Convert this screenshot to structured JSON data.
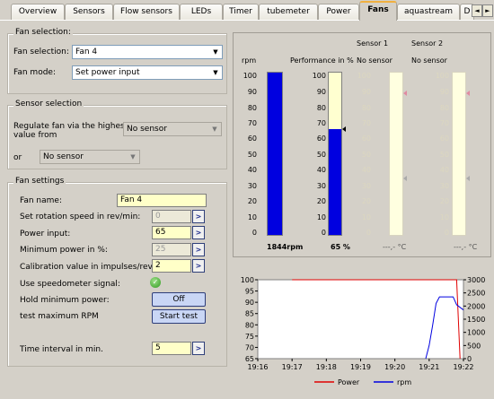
{
  "tabs": [
    "Overview",
    "Sensors",
    "Flow sensors",
    "LEDs",
    "Timer",
    "tubemeter",
    "Power",
    "Fans",
    "aquastream",
    "D"
  ],
  "active_tab": "Fans",
  "tab_scroll": {
    "left": "◄",
    "right": "►"
  },
  "fan_selection": {
    "title": "Fan selection:",
    "fan_label": "Fan selection:",
    "fan_value": "Fan 4",
    "mode_label": "Fan mode:",
    "mode_value": "Set power input"
  },
  "sensor_selection": {
    "title": "Sensor selection",
    "regulate_label_1": "Regulate fan via the highest",
    "regulate_label_2": "value from",
    "sensor1_value": "No sensor",
    "or_label": "or",
    "sensor2_value": "No sensor"
  },
  "fan_settings": {
    "title": "Fan settings",
    "name_label": "Fan name:",
    "name_value": "Fan 4",
    "rotation_label": "Set rotation speed in rev/min:",
    "rotation_value": "0",
    "power_label": "Power input:",
    "power_value": "65",
    "minpower_label": "Minimum power in %:",
    "minpower_value": "25",
    "calib_label": "Calibration value in impulses/rev:",
    "calib_value": "2",
    "speedometer_label": "Use speedometer signal:",
    "holdmin_label": "Hold minimum power:",
    "holdmin_button": "Off",
    "testmax_label": "test maximum RPM",
    "testmax_button": "Start test",
    "interval_label": "Time interval in min.",
    "interval_value": "5",
    "spin_symbol": ">"
  },
  "gauges": {
    "ticks": [
      "100",
      "90",
      "80",
      "70",
      "60",
      "50",
      "40",
      "30",
      "20",
      "10",
      "0"
    ],
    "rpm": {
      "header": "rpm",
      "value": "1844rpm",
      "level": 1.0,
      "color": "#0000e0"
    },
    "performance": {
      "header": "Performance in %",
      "value": "65 %",
      "level": 0.65,
      "color": "#0000e0"
    },
    "sensor1": {
      "header": "Sensor 1",
      "status": "No sensor",
      "value": "---,- °C"
    },
    "sensor2": {
      "header": "Sensor 2",
      "status": "No sensor",
      "value": "---,- °C"
    }
  },
  "chart_data": {
    "type": "line",
    "x_ticks": [
      "19:16",
      "19:17",
      "19:18",
      "19:19",
      "19:20",
      "19:21",
      "19:22"
    ],
    "y_left_ticks": [
      "100",
      "95",
      "90",
      "85",
      "80",
      "75",
      "70",
      "65"
    ],
    "y_right_ticks": [
      "3000",
      "2500",
      "2000",
      "1500",
      "1000",
      "500",
      "0"
    ],
    "y_left_range": [
      65,
      100
    ],
    "y_right_range": [
      0,
      3000
    ],
    "x_range_min": [
      0,
      6
    ],
    "series": [
      {
        "name": "Power",
        "color": "#e00000",
        "axis": "left",
        "points": [
          [
            1,
            100
          ],
          [
            5.8,
            100
          ],
          [
            5.9,
            65
          ]
        ]
      },
      {
        "name": "rpm",
        "color": "#0000e0",
        "axis": "right",
        "points": [
          [
            4.9,
            0
          ],
          [
            5.0,
            500
          ],
          [
            5.1,
            1250
          ],
          [
            5.2,
            2100
          ],
          [
            5.3,
            2350
          ],
          [
            5.7,
            2350
          ],
          [
            5.8,
            2050
          ],
          [
            6.0,
            1850
          ]
        ]
      }
    ],
    "legend": [
      "Power",
      "rpm"
    ],
    "grid": false
  }
}
